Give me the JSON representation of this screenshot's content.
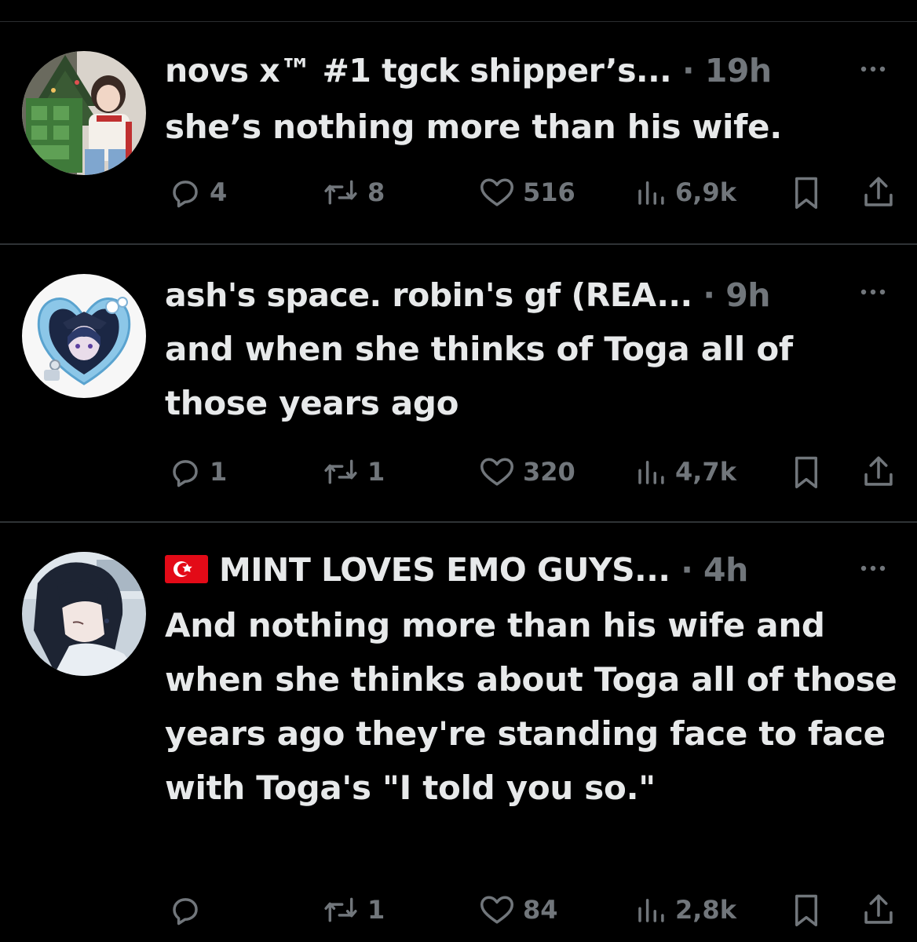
{
  "posts": [
    {
      "name": "novs x™ #1 tgck shipper’s...",
      "separator": "·",
      "time": "19h",
      "text": "she’s nothing more than his wife.",
      "replies": "4",
      "reposts": "8",
      "likes": "516",
      "views": "6,9k"
    },
    {
      "name": "ash's space. robin's gf (REA...",
      "separator": "·",
      "time": "9h",
      "text": "and when she thinks of Toga all of those years ago",
      "replies": "1",
      "reposts": "1",
      "likes": "320",
      "views": "4,7k"
    },
    {
      "name": "MINT LOVES EMO GUYS...",
      "separator": "·",
      "time": "4h",
      "text": "And nothing more than his wife and when she thinks about Toga all of those years ago they're standing face to face with Toga's \"I told you so.\"",
      "replies": "",
      "reposts": "1",
      "likes": "84",
      "views": "2,8k"
    }
  ],
  "icons": {
    "reply": "reply-icon",
    "repost": "repost-icon",
    "like": "heart-icon",
    "views": "views-icon",
    "bookmark": "bookmark-icon",
    "share": "share-icon",
    "more": "more-icon",
    "flag": "turkey-flag-icon"
  },
  "colors": {
    "background": "#000000",
    "text": "#e7e9ea",
    "secondary": "#71767b",
    "divider": "#2f3336",
    "flag_red": "#e30a17"
  }
}
